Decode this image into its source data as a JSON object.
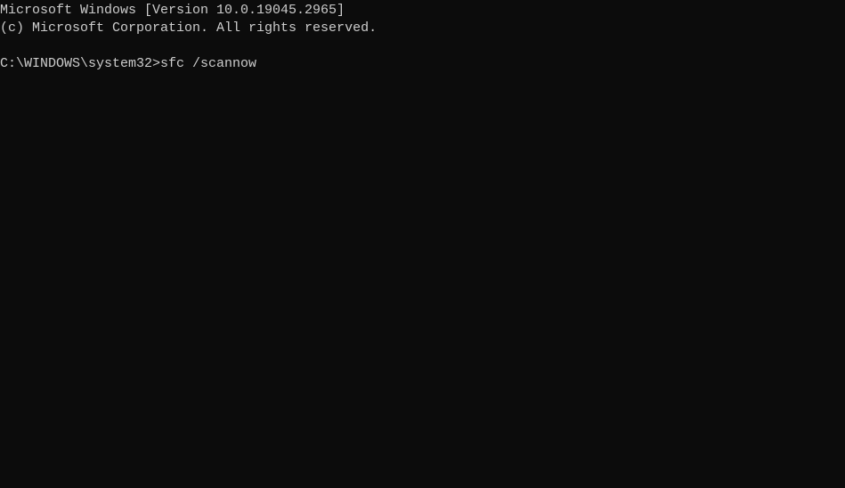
{
  "terminal": {
    "header_line1": "Microsoft Windows [Version 10.0.19045.2965]",
    "header_line2": "(c) Microsoft Corporation. All rights reserved.",
    "prompt": "C:\\WINDOWS\\system32>",
    "command": "sfc /scannow"
  }
}
